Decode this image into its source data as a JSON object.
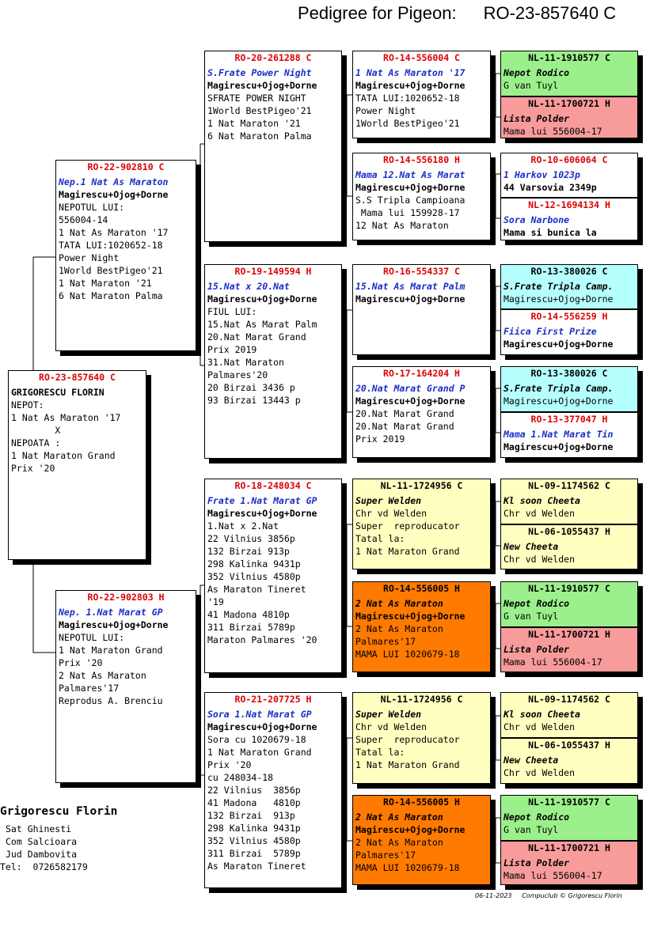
{
  "header": {
    "label": "Pedigree for Pigeon:",
    "ring": "RO-23-857640 C"
  },
  "subject": {
    "ring": "RO-23-857640 C",
    "lines": [
      "",
      "GRIGORESCU FLORIN",
      "",
      "NEPOT:",
      "1 Nat As Maraton '17",
      "        X",
      "NEPOATA :",
      "1 Nat Maraton Grand",
      "Prix '20"
    ]
  },
  "sire": {
    "ring": "RO-22-902810 C",
    "nick": "Nep.1 Nat As Maraton",
    "strain": "Magirescu+Ojog+Dorne",
    "lines": [
      "NEPOTUL LUI:",
      "556004-14",
      "1 Nat As Maraton '17",
      "TATA LUI:1020652-18",
      "Power Night",
      "1World BestPigeo'21",
      "1 Nat Maraton '21",
      "6 Nat Maraton Palma"
    ]
  },
  "dam": {
    "ring": "RO-22-902803 H",
    "nick": "Nep. 1.Nat Marat GP",
    "strain": "Magirescu+Ojog+Dorne",
    "lines": [
      "NEPOTUL LUI:",
      "1 Nat Maraton Grand",
      "Prix '20",
      "2 Nat As Maraton",
      "Palmares'17",
      "Reprodus A. Brenciu"
    ]
  },
  "ss": {
    "ring": "RO-20-261288 C",
    "nick": "S.Frate Power Night",
    "strain": "Magirescu+Ojog+Dorne",
    "lines": [
      "SFRATE POWER NIGHT",
      "1World BestPigeo'21",
      "1 Nat Maraton '21",
      "6 Nat Maraton Palma"
    ]
  },
  "sd": {
    "ring": "RO-19-149594 H",
    "nick": "15.Nat x 20.Nat",
    "strain": "Magirescu+Ojog+Dorne",
    "lines": [
      "FIUL LUI:",
      "15.Nat As Marat Palm",
      "20.Nat Marat Grand",
      "Prix 2019",
      "31.Nat Maraton",
      "Palmares'20",
      "20 Birzai 3436 p",
      "93 Birzai 13443 p"
    ]
  },
  "ds": {
    "ring": "RO-18-248034 C",
    "nick": "Frate 1.Nat Marat GP",
    "strain": "Magirescu+Ojog+Dorne",
    "lines": [
      "1.Nat x 2.Nat",
      "22 Vilnius 3856p",
      "132 Birzai 913p",
      "298 Kalinka 9431p",
      "352 Vilnius 4580p",
      "As Maraton Tineret",
      "'19",
      "41 Madona 4810p",
      "311 Birzai 5789p",
      "Maraton Palmares '20"
    ]
  },
  "dd": {
    "ring": "RO-21-207725 H",
    "nick": "Sora 1.Nat Marat GP",
    "strain": "Magirescu+Ojog+Dorne",
    "lines": [
      "Sora cu 1020679-18",
      "1 Nat Maraton Grand",
      "Prix '20",
      "cu 248034-18",
      "22 Vilnius  3856p",
      "41 Madona   4810p",
      "132 Birzai  913p",
      "298 Kalinka 9431p",
      "352 Vilnius 4580p",
      "311 Birzai  5789p",
      "As Maraton Tineret"
    ]
  },
  "sss": {
    "ring": "RO-14-556004 C",
    "nick": "1 Nat As Maraton '17",
    "strain": "Magirescu+Ojog+Dorne",
    "lines": [
      "TATA LUI:1020652-18",
      "Power Night",
      "1World BestPigeo'21"
    ]
  },
  "ssd": {
    "ring": "RO-14-556180 H",
    "nick": "Mama 12.Nat As Marat",
    "strain": "Magirescu+Ojog+Dorne",
    "lines": [
      "S.S Tripla Campioana",
      " Mama lui 159928-17",
      "12 Nat As Maraton"
    ]
  },
  "sds": {
    "ring": "RO-16-554337 C",
    "nick": "15.Nat As Marat Palm",
    "strain": "Magirescu+Ojog+Dorne",
    "lines": []
  },
  "sdd": {
    "ring": "RO-17-164204 H",
    "nick": "20.Nat Marat Grand P",
    "strain": "Magirescu+Ojog+Dorne",
    "lines": [
      "20.Nat Marat Grand",
      "20.Nat Marat Grand",
      "Prix 2019"
    ]
  },
  "dss": {
    "ring": "NL-11-1724956 C",
    "nick": "Super Welden",
    "strain": "Chr vd Welden",
    "lines": [
      "Super  reproducator",
      "Tatal la:",
      "1 Nat Maraton Grand"
    ]
  },
  "dsd": {
    "ring": "RO-14-556005 H",
    "nick": "2 Nat As Maraton",
    "strain": "Magirescu+Ojog+Dorne",
    "lines": [
      "2 Nat As Maraton",
      "Palmares'17",
      "MAMA LUI 1020679-18"
    ]
  },
  "dds": {
    "ring": "NL-11-1724956 C",
    "nick": "Super Welden",
    "strain": "Chr vd Welden",
    "lines": [
      "Super  reproducator",
      "Tatal la:",
      "1 Nat Maraton Grand"
    ]
  },
  "ddd": {
    "ring": "RO-14-556005 H",
    "nick": "2 Nat As Maraton",
    "strain": "Magirescu+Ojog+Dorne",
    "lines": [
      "2 Nat As Maraton",
      "Palmares'17",
      "MAMA LUI 1020679-18"
    ]
  },
  "g4": [
    {
      "ring": "NL-11-1910577 C",
      "nick": "Nepot Rodico",
      "strain": "G van Tuyl"
    },
    {
      "ring": "NL-11-1700721 H",
      "nick": "Lista Polder",
      "strain": "Mama lui 556004-17"
    },
    {
      "ring": "RO-10-606064 C",
      "nick": "1  Harkov   1023p",
      "strain": "44 Varsovia 2349p"
    },
    {
      "ring": "NL-12-1694134 H",
      "nick": "Sora Narbone",
      "strain": "Mama si bunica la"
    },
    {
      "ring": "RO-13-380026 C",
      "nick": "S.Frate Tripla Camp.",
      "strain": "Magirescu+Ojog+Dorne"
    },
    {
      "ring": "RO-14-556259 H",
      "nick": "Fiica First Prize",
      "strain": "Magirescu+Ojog+Dorne"
    },
    {
      "ring": "RO-13-380026 C",
      "nick": "S.Frate Tripla Camp.",
      "strain": "Magirescu+Ojog+Dorne"
    },
    {
      "ring": "RO-13-377047 H",
      "nick": "Mama 1.Nat Marat Tin",
      "strain": "Magirescu+Ojog+Dorne"
    },
    {
      "ring": "NL-09-1174562 C",
      "nick": "Kl soon Cheeta",
      "strain": "Chr vd Welden"
    },
    {
      "ring": "NL-06-1055437 H",
      "nick": "New Cheeta",
      "strain": "Chr vd Welden"
    },
    {
      "ring": "NL-11-1910577 C",
      "nick": "Nepot Rodico",
      "strain": "G van Tuyl"
    },
    {
      "ring": "NL-11-1700721 H",
      "nick": "Lista Polder",
      "strain": "Mama lui 556004-17"
    },
    {
      "ring": "NL-09-1174562 C",
      "nick": "Kl soon Cheeta",
      "strain": "Chr vd Welden"
    },
    {
      "ring": "NL-06-1055437 H",
      "nick": "New Cheeta",
      "strain": "Chr vd Welden"
    },
    {
      "ring": "NL-11-1910577 C",
      "nick": "Nepot Rodico",
      "strain": "G van Tuyl"
    },
    {
      "ring": "NL-11-1700721 H",
      "nick": "Lista Polder",
      "strain": "Mama lui 556004-17"
    }
  ],
  "owner": {
    "name": "Grigorescu Florin",
    "lines": [
      "Sat Ghinesti",
      "Com Salcioara",
      "Jud Dambovita"
    ],
    "tel": "Tel:  0726582179"
  },
  "footer": {
    "date": "06-11-2023",
    "credit": "Compuclub © Grigorescu Florin"
  },
  "colors": {
    "ring": "#e00000",
    "nick": "#1a2ec8",
    "yellow": "#ffffc0",
    "green": "#9cf08c",
    "pink": "#f79b9b",
    "cyan": "#b6ffff",
    "orange": "#ff7a00"
  }
}
